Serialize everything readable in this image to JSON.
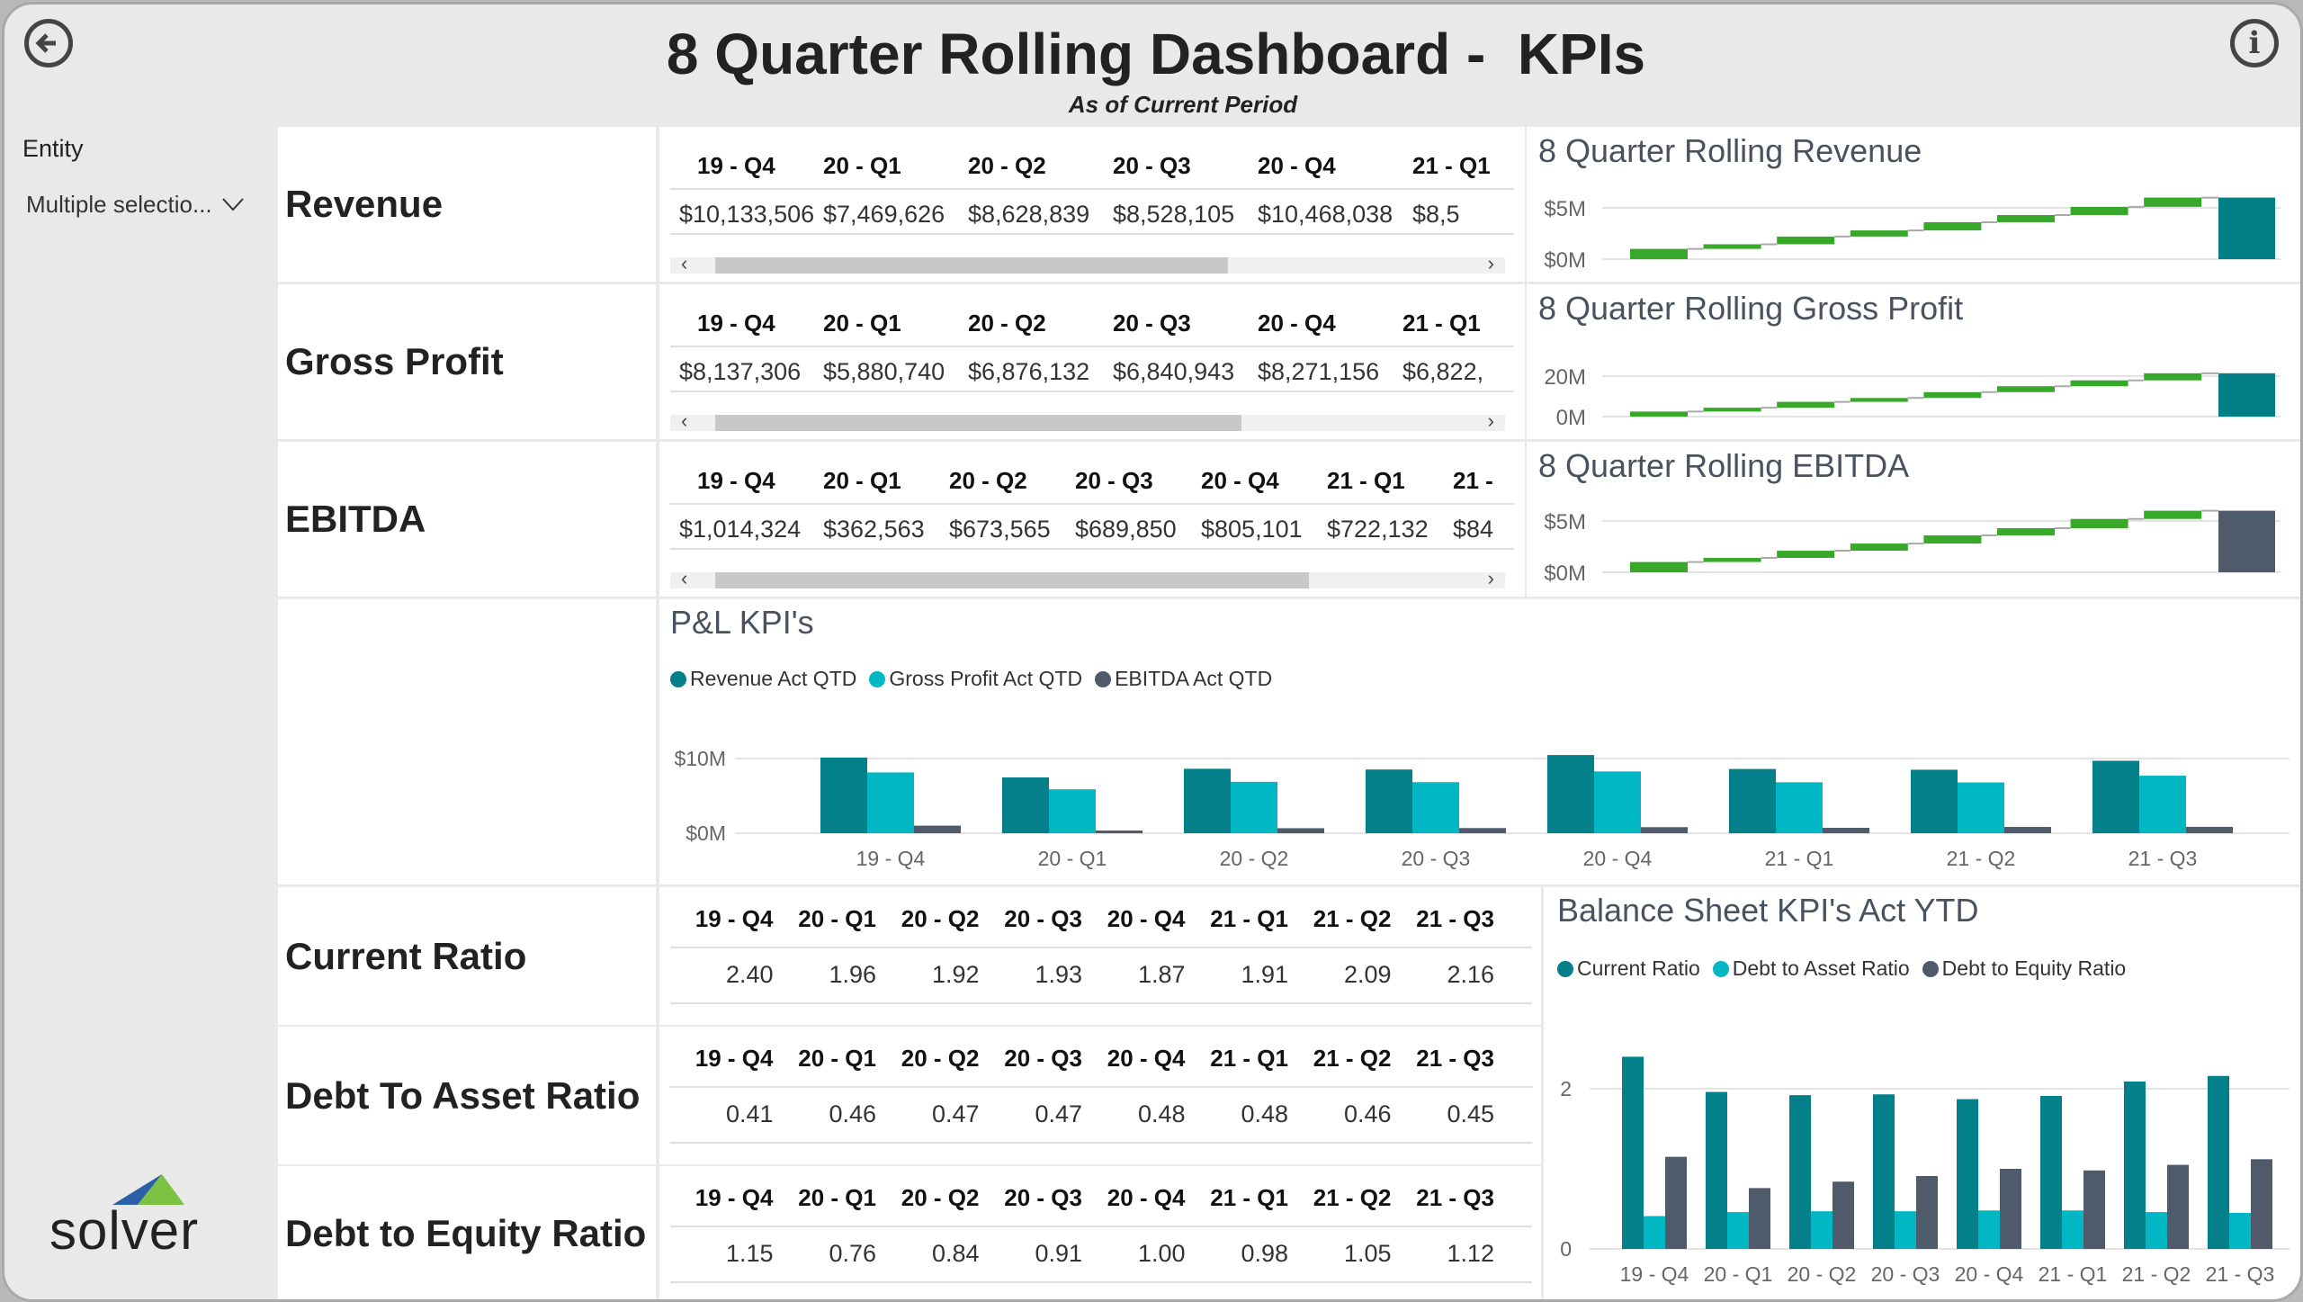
{
  "header": {
    "title": "8 Quarter Rolling Dashboard -  KPIs",
    "subtitle": "As of Current Period",
    "back_icon": "arrow-left-circle-icon",
    "info_icon": "info-circle-icon",
    "info_glyph": "i"
  },
  "sidebar": {
    "entity_label": "Entity",
    "entity_value": "Multiple selectio...",
    "logo_text": "solver"
  },
  "colors": {
    "green": "#37a829",
    "teal": "#037f86",
    "cyan": "#00b7c3",
    "slate": "#4f5b6b"
  },
  "kpi_tables": [
    {
      "label": "Revenue",
      "headers": [
        "19 - Q4",
        "20 - Q1",
        "20 - Q2",
        "20 - Q3",
        "20 - Q4",
        "21 - Q1"
      ],
      "values": [
        "$10,133,506",
        "$7,469,626",
        "$8,628,839",
        "$8,528,105",
        "$10,468,038",
        "$8,5"
      ]
    },
    {
      "label": "Gross Profit",
      "headers": [
        "19 - Q4",
        "20 - Q1",
        "20 - Q2",
        "20 - Q3",
        "20 - Q4",
        "21 - Q1"
      ],
      "values": [
        "$8,137,306",
        "$5,880,740",
        "$6,876,132",
        "$6,840,943",
        "$8,271,156",
        "$6,822,"
      ]
    },
    {
      "label": "EBITDA",
      "headers": [
        "19 - Q4",
        "20 - Q1",
        "20 - Q2",
        "20 - Q3",
        "20 - Q4",
        "21 - Q1",
        "21 -"
      ],
      "values": [
        "$1,014,324",
        "$362,563",
        "$673,565",
        "$689,850",
        "$805,101",
        "$722,132",
        "$84"
      ]
    }
  ],
  "ratio_tables": [
    {
      "label": "Current Ratio",
      "headers": [
        "19 - Q4",
        "20 - Q1",
        "20 - Q2",
        "20 - Q3",
        "20 - Q4",
        "21 - Q1",
        "21 - Q2",
        "21 - Q3"
      ],
      "values": [
        "2.40",
        "1.96",
        "1.92",
        "1.93",
        "1.87",
        "1.91",
        "2.09",
        "2.16"
      ]
    },
    {
      "label": "Debt To Asset Ratio",
      "headers": [
        "19 - Q4",
        "20 - Q1",
        "20 - Q2",
        "20 - Q3",
        "20 - Q4",
        "21 - Q1",
        "21 - Q2",
        "21 - Q3"
      ],
      "values": [
        "0.41",
        "0.46",
        "0.47",
        "0.47",
        "0.48",
        "0.48",
        "0.46",
        "0.45"
      ]
    },
    {
      "label": "Debt to Equity Ratio",
      "headers": [
        "19 - Q4",
        "20 - Q1",
        "20 - Q2",
        "20 - Q3",
        "20 - Q4",
        "21 - Q1",
        "21 - Q2",
        "21 - Q3"
      ],
      "values": [
        "1.15",
        "0.76",
        "0.84",
        "0.91",
        "1.00",
        "0.98",
        "1.05",
        "1.12"
      ]
    }
  ],
  "chart_data": [
    {
      "type": "waterfall",
      "title": "8 Quarter Rolling Revenue",
      "yticks": [
        "$5M",
        "$0M"
      ],
      "ytick_values": [
        5,
        0
      ],
      "unit": "$M",
      "cumulative": [
        1.0,
        1.45,
        2.2,
        2.8,
        3.6,
        4.3,
        5.1,
        6.0
      ],
      "total": 6.0,
      "step_color": "#37a829",
      "total_color": "#037f86"
    },
    {
      "type": "waterfall",
      "title": "8 Quarter Rolling Gross Profit",
      "yticks": [
        "20M",
        "0M"
      ],
      "ytick_values": [
        20,
        0
      ],
      "unit": "M",
      "cumulative": [
        2.5,
        4.4,
        7.3,
        9.2,
        12.1,
        15.0,
        17.9,
        21.4
      ],
      "total": 21.4,
      "step_color": "#37a829",
      "total_color": "#037f86"
    },
    {
      "type": "waterfall",
      "title": "8 Quarter Rolling EBITDA",
      "yticks": [
        "$5M",
        "$0M"
      ],
      "ytick_values": [
        5,
        0
      ],
      "unit": "$M",
      "cumulative": [
        1.0,
        1.4,
        2.1,
        2.8,
        3.6,
        4.3,
        5.2,
        6.0
      ],
      "total": 6.0,
      "step_color": "#37a829",
      "total_color": "#4f5b6b"
    },
    {
      "type": "bar",
      "title": "P&L KPI's",
      "categories": [
        "19 - Q4",
        "20 - Q1",
        "20 - Q2",
        "20 - Q3",
        "20 - Q4",
        "21 - Q1",
        "21 - Q2",
        "21 - Q3"
      ],
      "yticks": [
        "$10M",
        "$0M"
      ],
      "ytick_values": [
        10,
        0
      ],
      "unit": "$M",
      "legend_position": "top-left",
      "series": [
        {
          "name": "Revenue Act QTD",
          "color": "#03808a",
          "values": [
            10.13,
            7.47,
            8.63,
            8.53,
            10.47,
            8.6,
            8.5,
            9.7
          ]
        },
        {
          "name": "Gross Profit Act QTD",
          "color": "#00b7c3",
          "values": [
            8.14,
            5.88,
            6.88,
            6.84,
            8.27,
            6.82,
            6.8,
            7.7
          ]
        },
        {
          "name": "EBITDA Act QTD",
          "color": "#4f5b6b",
          "values": [
            1.01,
            0.36,
            0.67,
            0.69,
            0.81,
            0.72,
            0.84,
            0.85
          ]
        }
      ]
    },
    {
      "type": "bar",
      "title": "Balance Sheet KPI's Act YTD",
      "categories": [
        "19 - Q4",
        "20 - Q1",
        "20 - Q2",
        "20 - Q3",
        "20 - Q4",
        "21 - Q1",
        "21 - Q2",
        "21 - Q3"
      ],
      "yticks": [
        "2",
        "0"
      ],
      "ytick_values": [
        2,
        0
      ],
      "legend_position": "top-left",
      "series": [
        {
          "name": "Current Ratio",
          "color": "#03808a",
          "values": [
            2.4,
            1.96,
            1.92,
            1.93,
            1.87,
            1.91,
            2.09,
            2.16
          ]
        },
        {
          "name": "Debt to Asset Ratio",
          "color": "#00b7c3",
          "values": [
            0.41,
            0.46,
            0.47,
            0.47,
            0.48,
            0.48,
            0.46,
            0.45
          ]
        },
        {
          "name": "Debt to Equity Ratio",
          "color": "#4f5b6b",
          "values": [
            1.15,
            0.76,
            0.84,
            0.91,
            1.0,
            0.98,
            1.05,
            1.12
          ]
        }
      ]
    }
  ]
}
